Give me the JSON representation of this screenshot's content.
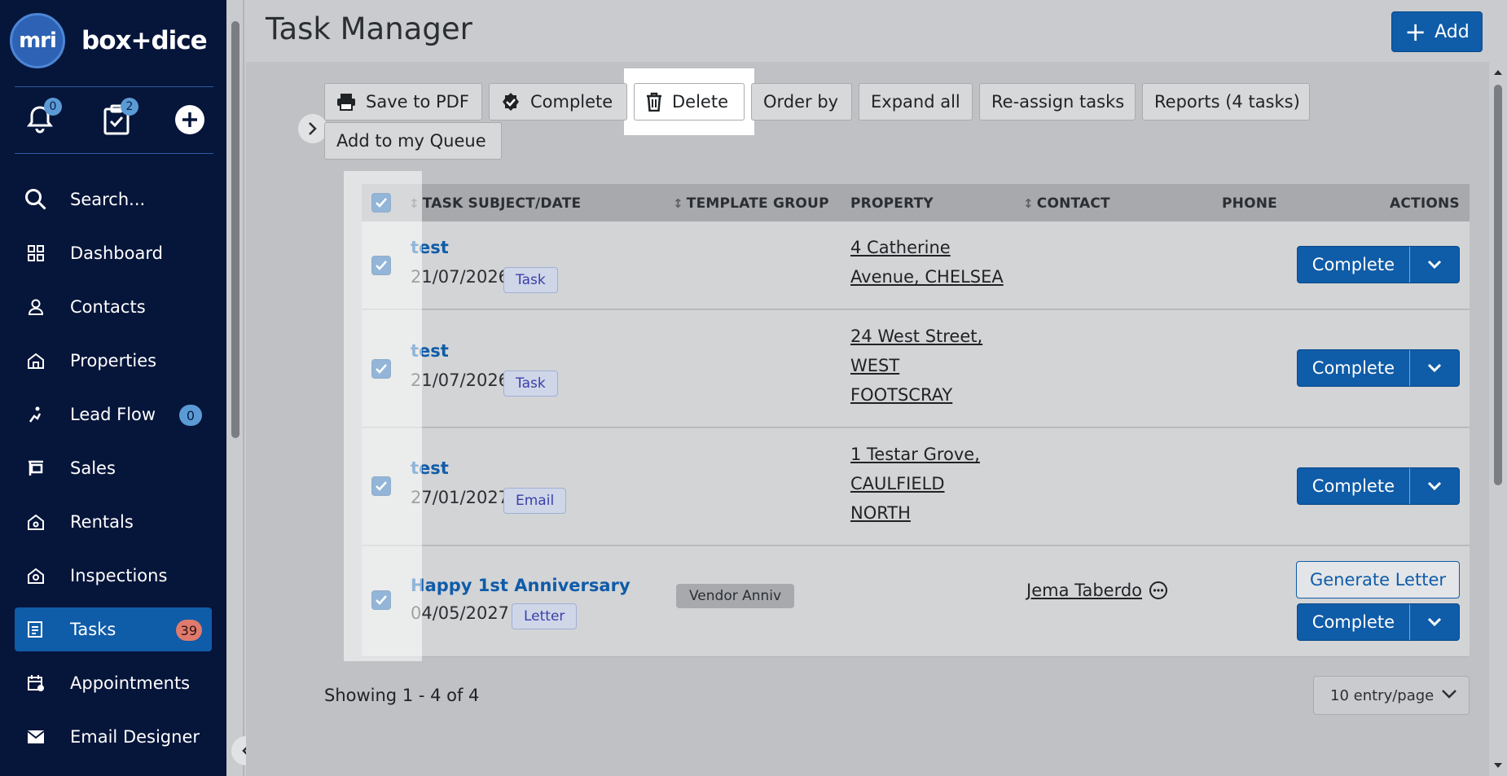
{
  "brand": {
    "logo_text": "mri",
    "name_left": "box",
    "name_plus": "+",
    "name_right": "dice"
  },
  "quick": {
    "notifications_count": "0",
    "tasks_count": "2"
  },
  "sidebar": {
    "search_label": "Search...",
    "items": [
      {
        "label": "Dashboard",
        "icon": "grid-icon"
      },
      {
        "label": "Contacts",
        "icon": "person-icon"
      },
      {
        "label": "Properties",
        "icon": "house-icon"
      },
      {
        "label": "Lead Flow",
        "icon": "lead-flow-icon",
        "badge": "0"
      },
      {
        "label": "Sales",
        "icon": "sales-icon"
      },
      {
        "label": "Rentals",
        "icon": "rentals-icon"
      },
      {
        "label": "Inspections",
        "icon": "inspections-icon"
      },
      {
        "label": "Tasks",
        "icon": "tasks-icon",
        "badge": "39",
        "active": true
      },
      {
        "label": "Appointments",
        "icon": "calendar-icon"
      },
      {
        "label": "Email Designer",
        "icon": "email-icon"
      }
    ]
  },
  "header": {
    "title": "Task Manager",
    "add_label": "Add"
  },
  "toolbar": {
    "save_pdf": "Save to PDF",
    "complete": "Complete",
    "delete": "Delete",
    "order_by": "Order by",
    "expand_all": "Expand all",
    "reassign": "Re-assign tasks",
    "reports": "Reports (4 tasks)",
    "add_queue": "Add to my Queue"
  },
  "table": {
    "columns": {
      "subject": "TASK SUBJECT/DATE",
      "template_group": "TEMPLATE GROUP",
      "property": "PROPERTY",
      "contact": "CONTACT",
      "phone": "PHONE",
      "actions": "ACTIONS"
    },
    "rows": [
      {
        "subject": "test",
        "date": "21/07/2026",
        "type": "Task",
        "property_line1": "4 Catherine",
        "property_line2": "Avenue, CHELSEA",
        "property_line3": "",
        "template_group": "",
        "contact": "",
        "action": "Complete"
      },
      {
        "subject": "test",
        "date": "21/07/2026",
        "type": "Task",
        "property_line1": "24 West Street,",
        "property_line2": "WEST",
        "property_line3": "FOOTSCRAY",
        "template_group": "",
        "contact": "",
        "action": "Complete"
      },
      {
        "subject": "test",
        "date": "27/01/2027",
        "type": "Email",
        "property_line1": "1 Testar Grove,",
        "property_line2": "CAULFIELD",
        "property_line3": "NORTH",
        "template_group": "",
        "contact": "",
        "action": "Complete"
      },
      {
        "subject": "Happy 1st Anniversary",
        "date": "04/05/2027",
        "type": "Letter",
        "property_line1": "",
        "property_line2": "",
        "property_line3": "",
        "template_group": "Vendor Anniv",
        "contact": "Jema Taberdo",
        "action": "Complete",
        "secondary_action": "Generate Letter"
      }
    ]
  },
  "footer": {
    "showing": "Showing 1 - 4 of 4",
    "page_size": "10 entry/page"
  },
  "colors": {
    "sidebar_bg": "#06153a",
    "accent": "#0f5ca8",
    "badge_blue": "#5b9bd5",
    "badge_red": "#e07a6d"
  }
}
